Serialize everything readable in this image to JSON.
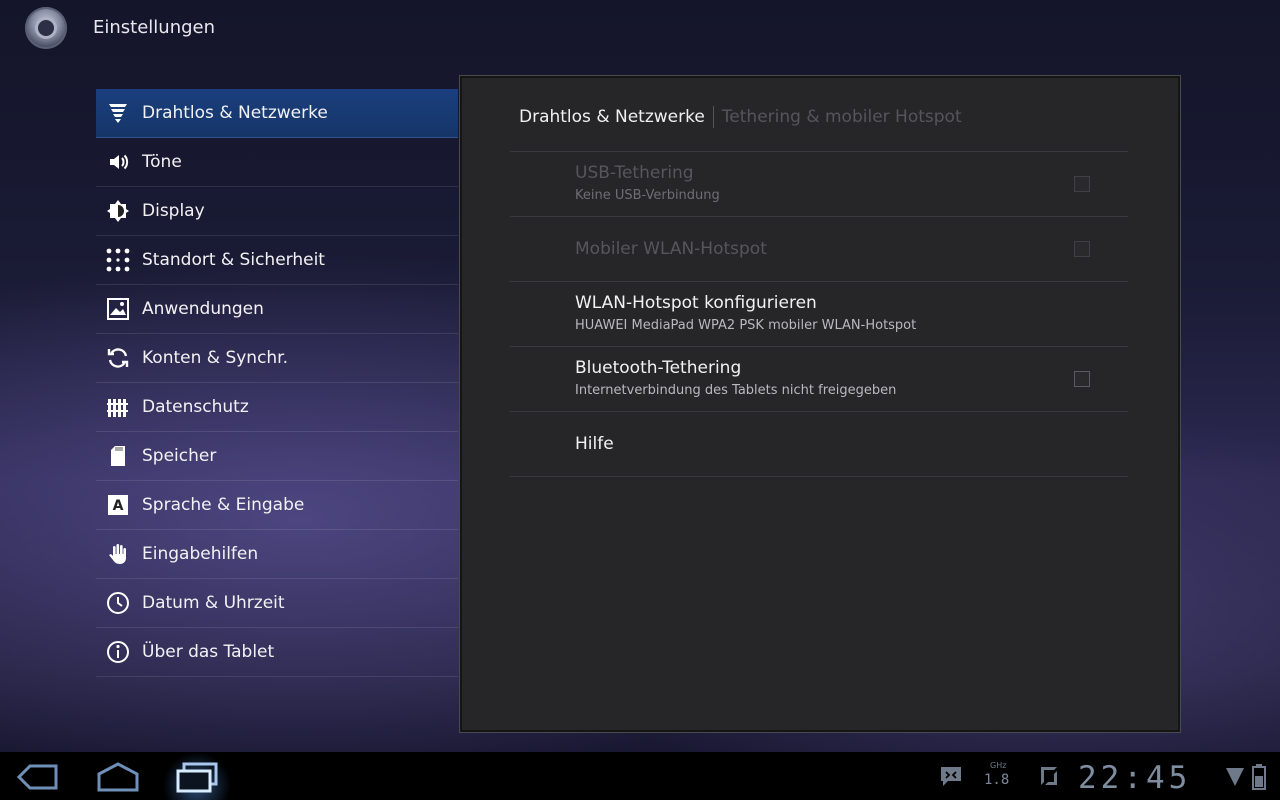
{
  "app": {
    "title": "Einstellungen",
    "icon": "settings-app-icon"
  },
  "headers": [
    {
      "label": "Drahtlos & Netzwerke",
      "icon": "wireless-icon",
      "selected": true
    },
    {
      "label": "Töne",
      "icon": "speaker-icon"
    },
    {
      "label": "Display",
      "icon": "brightness-icon"
    },
    {
      "label": "Standort & Sicherheit",
      "icon": "location-grid-icon"
    },
    {
      "label": "Anwendungen",
      "icon": "applications-icon"
    },
    {
      "label": "Konten & Synchr.",
      "icon": "sync-icon"
    },
    {
      "label": "Datenschutz",
      "icon": "privacy-fence-icon"
    },
    {
      "label": "Speicher",
      "icon": "sd-card-icon"
    },
    {
      "label": "Sprache & Eingabe",
      "icon": "keyboard-letter-icon"
    },
    {
      "label": "Eingabehilfen",
      "icon": "hand-icon"
    },
    {
      "label": "Datum & Uhrzeit",
      "icon": "clock-icon"
    },
    {
      "label": "Über das Tablet",
      "icon": "info-icon"
    }
  ],
  "breadcrumb": {
    "first": "Drahtlos & Netzwerke",
    "second": "Tethering & mobiler Hotspot"
  },
  "preferences": [
    {
      "title": "USB-Tethering",
      "summary": "Keine USB-Verbindung",
      "enabled": false,
      "checkbox": true,
      "checked": false
    },
    {
      "title": "Mobiler WLAN-Hotspot",
      "summary": "",
      "enabled": false,
      "checkbox": true,
      "checked": false
    },
    {
      "title": "WLAN-Hotspot konfigurieren",
      "summary": "HUAWEI MediaPad WPA2 PSK mobiler WLAN-Hotspot",
      "enabled": true,
      "checkbox": false
    },
    {
      "title": "Bluetooth-Tethering",
      "summary": "Internetverbindung des Tablets nicht freigegeben",
      "enabled": true,
      "checkbox": true,
      "checked": false
    },
    {
      "title": "Hilfe",
      "summary": "",
      "enabled": true,
      "checkbox": false
    }
  ],
  "system_bar": {
    "back_icon": "back-icon",
    "home_icon": "home-icon",
    "recents_icon": "recent-apps-icon",
    "ghz_label": "GHz",
    "ghz_value": "1.8",
    "clock": "22:45",
    "colors": {
      "status": "#7f8da0"
    }
  }
}
